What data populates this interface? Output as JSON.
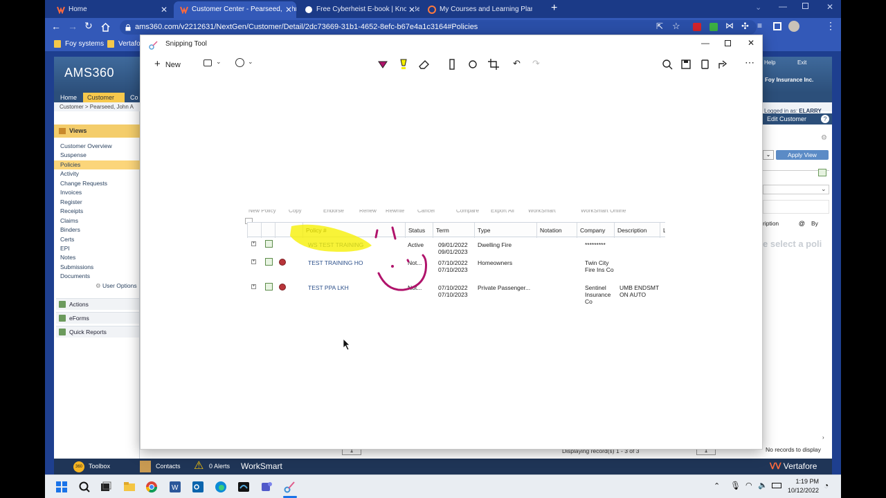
{
  "browser": {
    "tabs": [
      {
        "title": "Home",
        "active": false
      },
      {
        "title": "Customer Center - Pearseed, John",
        "active": true
      },
      {
        "title": "Free Cyberheist E-book | KnowBe",
        "active": false
      },
      {
        "title": "My Courses and Learning Plans",
        "active": false
      }
    ],
    "new_tab": "+",
    "url": "ams360.com/v2212631/NextGen/Customer/Detail/2dc73669-31b1-4652-8efc-b67e4a1c3164#Policies",
    "bookmarks": [
      "Foy systems",
      "Vertafore"
    ]
  },
  "ams": {
    "logo": "AMS360",
    "nav": [
      "Home",
      "Customer",
      "Co"
    ],
    "breadcrumb": "Customer  >  Pearseed, John A",
    "header_links": {
      "help": "Help",
      "exit": "Exit"
    },
    "agency": "Foy Insurance Inc.",
    "logged_in": "Logged in as:",
    "user": "ELARRY",
    "edit_customer": "Edit Customer",
    "apply_view": "Apply View",
    "views_title": "Views",
    "views": [
      "Customer Overview",
      "Suspense",
      "Policies",
      "Activity",
      "Change Requests",
      "Invoices",
      "Register",
      "Receipts",
      "Claims",
      "Binders",
      "Certs",
      "EPI",
      "Notes",
      "Submissions",
      "Documents"
    ],
    "selected_view": "Policies",
    "user_options": "User Options",
    "panels": [
      "Actions",
      "eForms",
      "Quick Reports"
    ],
    "right_headers": {
      "description": "ription",
      "by": "By"
    },
    "right_hint": "e select a poli",
    "no_records": "No records to display",
    "displaying": "Displaying record(s) 1 - 3 of 3",
    "page_num": "1",
    "bottom_bar": {
      "toolbox": "Toolbox",
      "contacts": "Contacts",
      "alerts": "0 Alerts",
      "worksmart": "WorkSmart",
      "brand": "Vertafore"
    }
  },
  "snip": {
    "title": "Snipping Tool",
    "new_label": "New",
    "capture": {
      "toolbar": [
        "New Policy",
        "Copy",
        "Endorse",
        "Renew",
        "Rewrite",
        "Cancel",
        "Compare",
        "Export All",
        "WorkSmart",
        "WorkSmart Online"
      ],
      "headers": [
        "Policy #",
        "Status",
        "Term",
        "Type",
        "Notation",
        "Company",
        "Description",
        "L"
      ],
      "rows": [
        {
          "policy": "WS TEST TRAINING",
          "status": "Active",
          "term_start": "09/01/2022",
          "term_end": "09/01/2023",
          "type": "Dwelling Fire",
          "notation": "",
          "company": "*********",
          "description": ""
        },
        {
          "policy": "TEST TRAINING HO",
          "status": "Not...",
          "term_start": "07/10/2022",
          "term_end": "07/10/2023",
          "type": "Homeowners",
          "notation": "",
          "company": "Twin City Fire Ins Co",
          "description": ""
        },
        {
          "policy": "TEST PPA LKH",
          "status": "Not...",
          "term_start": "07/10/2022",
          "term_end": "07/10/2023",
          "type": "Private Passenger...",
          "notation": "",
          "company": "Sentinel Insurance Co",
          "description": "UMB ENDSMT ON AUTO"
        }
      ]
    }
  },
  "taskbar": {
    "time": "1:19 PM",
    "date": "10/12/2022"
  },
  "colors": {
    "browser_frame": "#1b3a87",
    "highlight": "#f6f000",
    "pen": "#b0136b",
    "ams_header": "#2c4f7a"
  }
}
